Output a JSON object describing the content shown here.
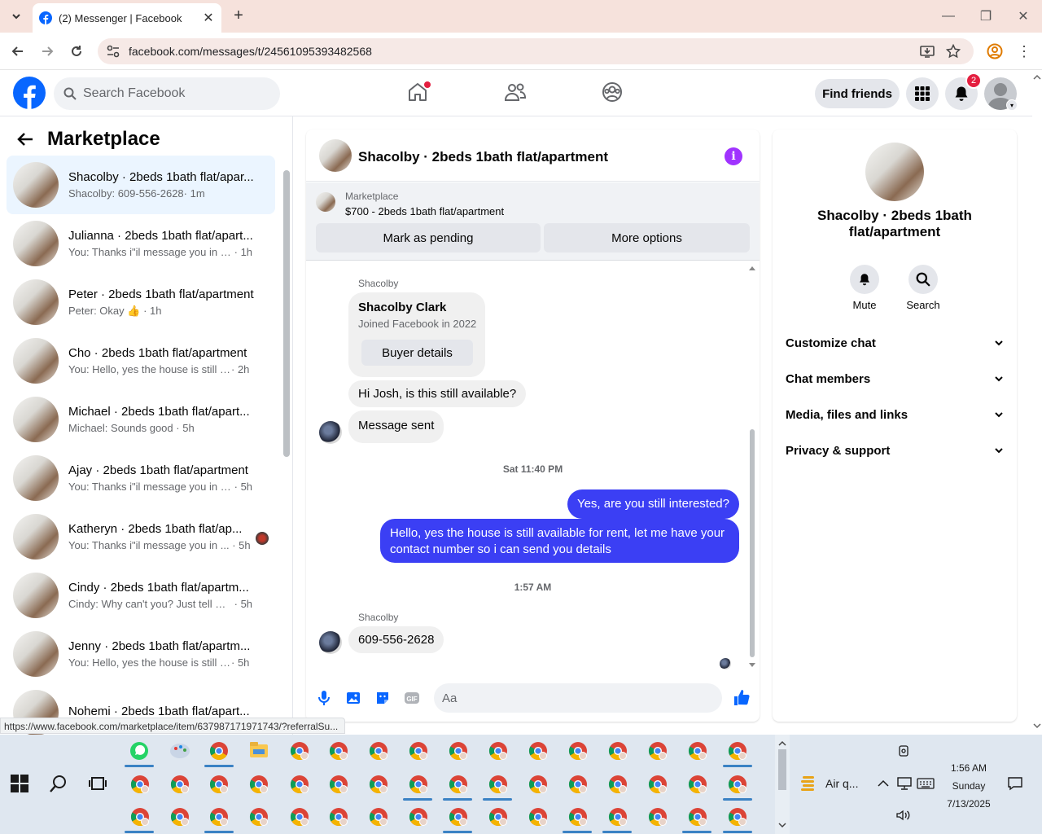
{
  "browser": {
    "tab_title": "(2) Messenger | Facebook",
    "url": "facebook.com/messages/t/24561095393482568",
    "status_url": "https://www.facebook.com/marketplace/item/637987171971743/?referralSu..."
  },
  "header": {
    "search_placeholder": "Search Facebook",
    "find_friends": "Find friends",
    "notif_count": "2"
  },
  "sidebar": {
    "title": "Marketplace",
    "conversations": [
      {
        "name": "Shacolby · 2beds 1bath flat/apar...",
        "preview": "Shacolby: 609-556-2628",
        "time": "· 1m",
        "active": true
      },
      {
        "name": "Julianna · 2beds 1bath flat/apart...",
        "preview": "You: Thanks i\"il message you in a ...",
        "time": "· 1h"
      },
      {
        "name": "Peter · 2beds 1bath flat/apartment",
        "preview": "Peter: Okay 👍",
        "time": "· 1h"
      },
      {
        "name": "Cho · 2beds 1bath flat/apartment",
        "preview": "You: Hello, yes the house is still avai...",
        "time": "· 2h"
      },
      {
        "name": "Michael · 2beds 1bath flat/apart...",
        "preview": "Michael: Sounds good",
        "time": "· 5h"
      },
      {
        "name": "Ajay · 2beds 1bath flat/apartment",
        "preview": "You: Thanks i\"il message you in a ...",
        "time": "· 5h"
      },
      {
        "name": "Katheryn · 2beds 1bath flat/ap...",
        "preview": "You: Thanks i\"il message you in ...",
        "time": "· 5h"
      },
      {
        "name": "Cindy · 2beds 1bath flat/apartm...",
        "preview": "Cindy: Why can't you? Just tell me ...",
        "time": "· 5h"
      },
      {
        "name": "Jenny · 2beds 1bath flat/apartm...",
        "preview": "You: Hello, yes the house is still avai...",
        "time": "· 5h"
      },
      {
        "name": "Nohemi · 2beds 1bath flat/apart...",
        "preview": "",
        "time": ""
      }
    ]
  },
  "chat": {
    "title": "Shacolby · 2beds 1bath flat/apartment",
    "marketplace_label": "Marketplace",
    "listing": "$700 - 2beds 1bath flat/apartment",
    "mark_pending": "Mark as pending",
    "more_options": "More options",
    "sender_name": "Shacolby",
    "card_name": "Shacolby Clark",
    "card_joined": "Joined Facebook in 2022",
    "buyer_details": "Buyer details",
    "msg_in_1": "Hi Josh, is this still available?",
    "msg_in_2": "Message sent",
    "stamp_1": "Sat 11:40 PM",
    "msg_out_1": "Yes, are you still interested?",
    "msg_out_2": "Hello, yes the house is still available for rent, let me have your contact number so i can send you details",
    "stamp_2": "1:57 AM",
    "msg_in_3": "609-556-2628",
    "composer_placeholder": "Aa"
  },
  "details": {
    "name": "Shacolby · 2beds 1bath flat/apartment",
    "mute": "Mute",
    "search": "Search",
    "sections": [
      "Customize chat",
      "Chat members",
      "Media, files and links",
      "Privacy & support"
    ]
  },
  "taskbar": {
    "air": "Air q...",
    "time": "1:56 AM",
    "day": "Sunday",
    "date": "7/13/2025"
  },
  "colors": {
    "fb_blue": "#0866ff",
    "outgoing_bubble": "#3b3ff4",
    "info_purple": "#a033ff",
    "notif_red": "#e41e3f"
  }
}
